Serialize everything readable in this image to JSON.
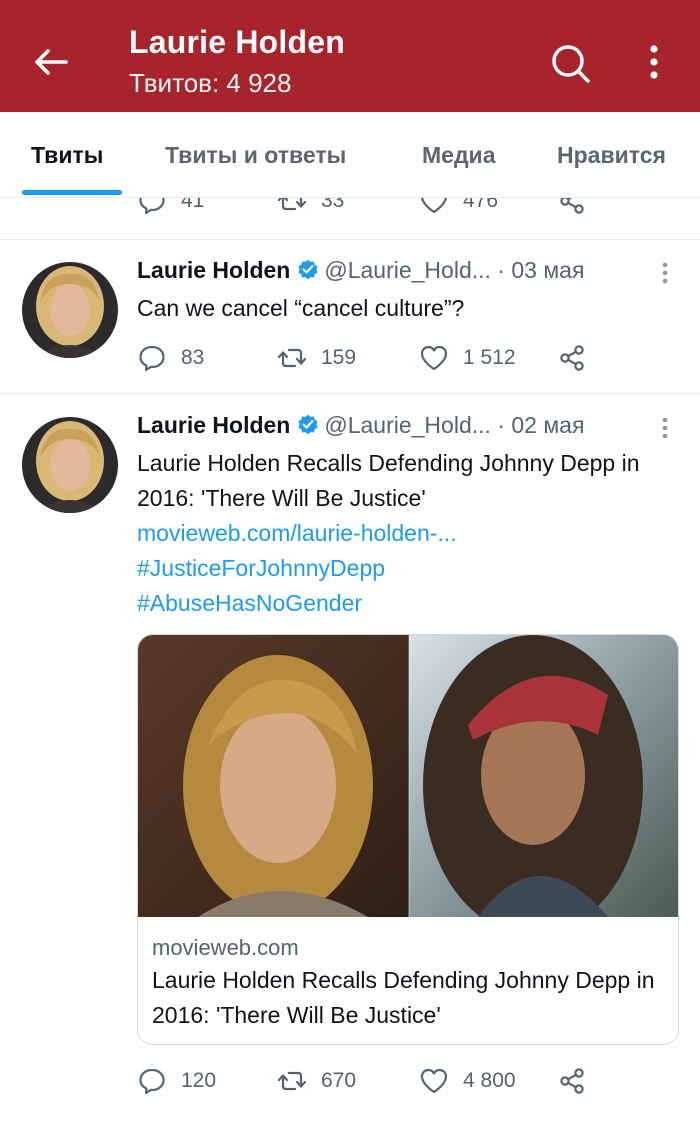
{
  "appbar": {
    "title": "Laurie Holden",
    "subtitle": "Твитов: 4 928",
    "back_icon": "arrow-left-icon",
    "search_icon": "search-icon",
    "more_icon": "more-vertical-icon",
    "background": "#a8242d"
  },
  "tabs": [
    {
      "label": "Твиты",
      "active": true
    },
    {
      "label": "Твиты и ответы",
      "active": false
    },
    {
      "label": "Медиа",
      "active": false
    },
    {
      "label": "Нравится",
      "active": false
    }
  ],
  "previous_tweet": {
    "replies": "41",
    "retweets": "33",
    "likes": "476"
  },
  "tweets": [
    {
      "name": "Laurie Holden",
      "handle": "@Laurie_Hold...",
      "date": "· 03 мая",
      "text": "Can we cancel “cancel culture”?",
      "replies": "83",
      "retweets": "159",
      "likes": "1 512"
    },
    {
      "name": "Laurie Holden",
      "handle": "@Laurie_Hold...",
      "date": "· 02 мая",
      "text": "Laurie Holden Recalls Defending Johnny Depp in 2016: 'There Will Be Justice'",
      "link": "movieweb.com/laurie-holden-...",
      "hashtag1": "#JusticeForJohnnyDepp",
      "hashtag2": "#AbuseHasNoGender",
      "card": {
        "domain": "movieweb.com",
        "title": "Laurie Holden Recalls Defending Johnny Depp in 2016: 'There Will Be Justice'"
      },
      "replies": "120",
      "retweets": "670",
      "likes": "4 800"
    }
  ],
  "colors": {
    "accent": "#1d9bf0",
    "muted": "#536471",
    "divider": "#e6e9ec"
  }
}
